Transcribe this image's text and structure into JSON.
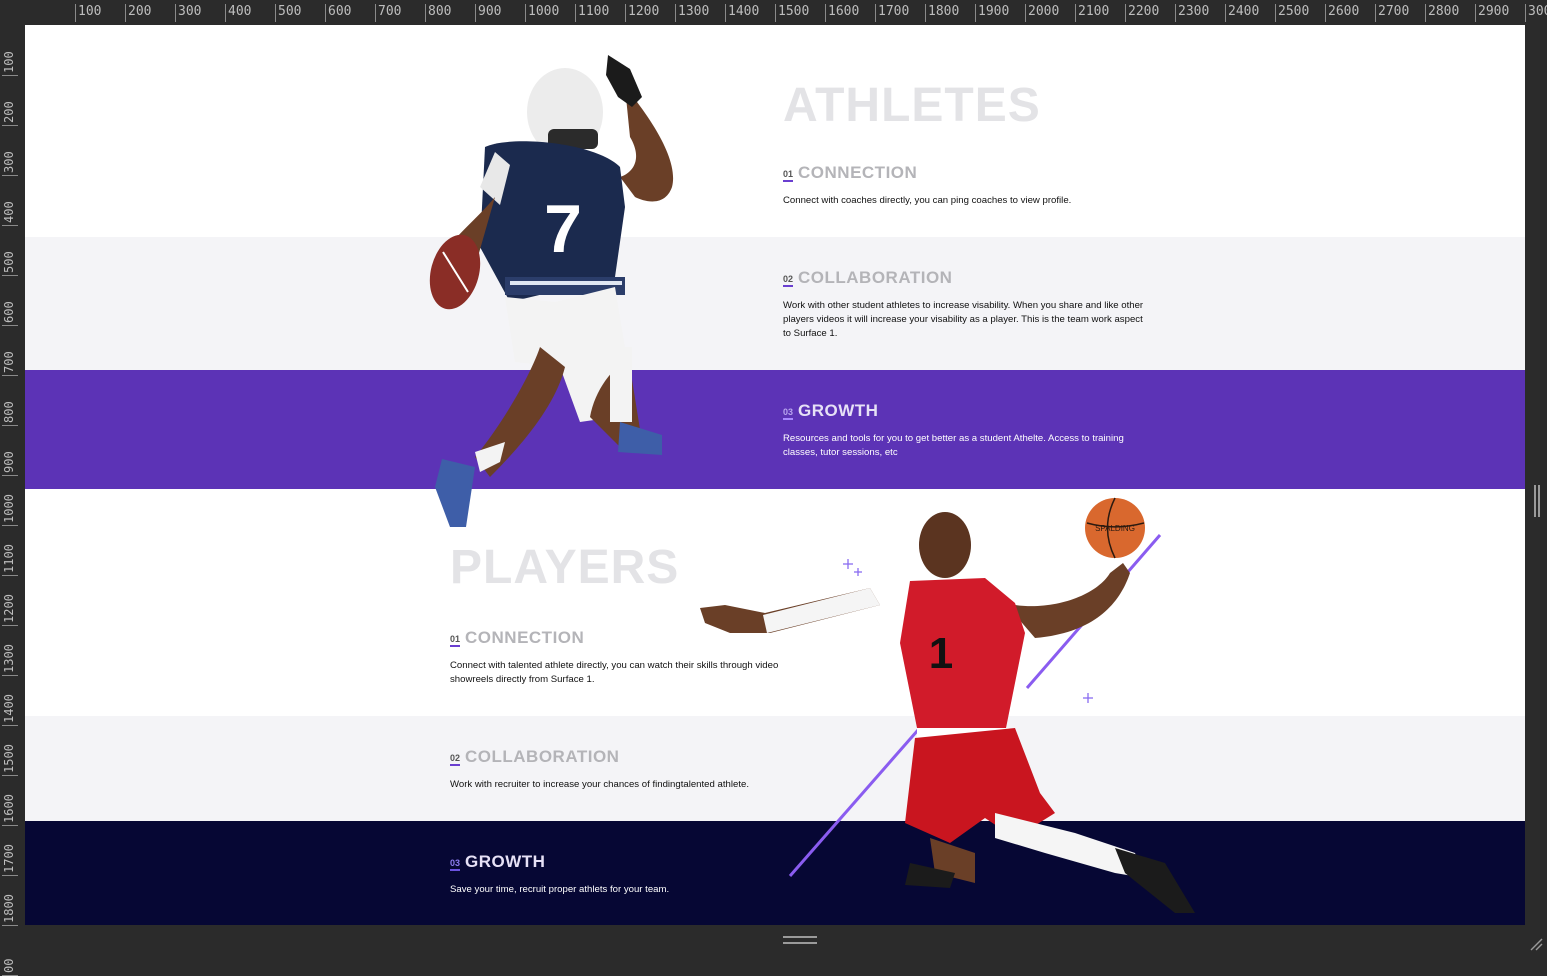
{
  "ruler": {
    "top": [
      "100",
      "200",
      "300",
      "400",
      "500",
      "600",
      "700",
      "800",
      "900",
      "1000",
      "1100",
      "1200",
      "1300",
      "1400",
      "1500",
      "1600",
      "1700",
      "1800",
      "1900",
      "2000",
      "2100",
      "2200",
      "2300",
      "2400",
      "2500",
      "2600",
      "2700",
      "2800",
      "2900",
      "300"
    ],
    "left": [
      "100",
      "200",
      "300",
      "400",
      "500",
      "600",
      "700",
      "800",
      "900",
      "1000",
      "1100",
      "1200",
      "1300",
      "1400",
      "1500",
      "1600",
      "1700",
      "1800",
      "00"
    ]
  },
  "athletes": {
    "title": "ATHLETES",
    "items": [
      {
        "num": "01",
        "title": "CONNECTION",
        "text": "Connect with coaches directly, you can ping coaches to view profile."
      },
      {
        "num": "02",
        "title": "COLLABORATION",
        "text": "Work with other student athletes to increase visability. When you share and like other players videos it will increase your visability as a player. This is the team work aspect to Surface 1."
      },
      {
        "num": "03",
        "title": "GROWTH",
        "text": "Resources and tools for you to get better as a student Athelte. Access to training classes, tutor sessions, etc"
      }
    ]
  },
  "players": {
    "title": "PLAYERS",
    "items": [
      {
        "num": "01",
        "title": "CONNECTION",
        "text": "Connect with talented athlete directly, you can watch their skills through video showreels directly from Surface 1."
      },
      {
        "num": "02",
        "title": "COLLABORATION",
        "text": "Work with recruiter to increase your chances of findingtalented athlete."
      },
      {
        "num": "03",
        "title": "GROWTH",
        "text": "Save your time, recruit proper athlets for your team."
      }
    ]
  },
  "images": {
    "football_jersey": "7",
    "basketball_jersey": "1",
    "ball_brand": "SPALDING"
  },
  "colors": {
    "purple_band": "#5c33b6",
    "navy_band": "#060734",
    "light_band": "#f4f4f7",
    "accent": "#6a3fd0"
  }
}
